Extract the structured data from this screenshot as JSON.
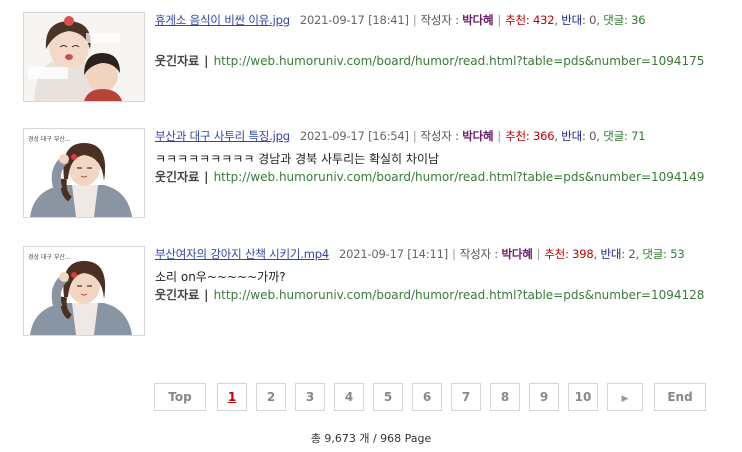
{
  "posts": [
    {
      "title": "휴게소 음식이 비싼 이유.jpg",
      "date": "2021-09-17 [18:41]",
      "author_label": "작성자 :",
      "author": "박다혜",
      "rec_label": "추천",
      "rec": ": 432",
      "opp_label": "반대",
      "opp": ": 0",
      "cmt_label": "댓글",
      "cmt": ": 36",
      "body": "",
      "src_label": "웃긴자료",
      "link": "http://web.humoruniv.com/board/humor/read.html?table=pds&number=1094175"
    },
    {
      "title": "부산과 대구 사투리 특징.jpg",
      "date": "2021-09-17 [16:54]",
      "author_label": "작성자 :",
      "author": "박다혜",
      "rec_label": "추천",
      "rec": ": 366",
      "opp_label": "반대",
      "opp": ": 0",
      "cmt_label": "댓글",
      "cmt": ": 71",
      "body": "ㅋㅋㅋㅋㅋㅋㅋㅋㅋ 경남과 경북 사투리는 확실히 차이남",
      "src_label": "웃긴자료",
      "link": "http://web.humoruniv.com/board/humor/read.html?table=pds&number=1094149"
    },
    {
      "title": "부산여자의 강아지 산책 시키기.mp4",
      "date": "2021-09-17 [14:11]",
      "author_label": "작성자 :",
      "author": "박다혜",
      "rec_label": "추천",
      "rec": ": 398",
      "opp_label": "반대",
      "opp": ": 2",
      "cmt_label": "댓글",
      "cmt": ": 53",
      "body": "소리 on우~~~~~가까?",
      "src_label": "웃긴자료",
      "link": "http://web.humoruniv.com/board/humor/read.html?table=pds&number=1094128"
    }
  ],
  "pagination": {
    "first": "Top",
    "pages": [
      "1",
      "2",
      "3",
      "4",
      "5",
      "6",
      "7",
      "8",
      "9",
      "10"
    ],
    "current": "1",
    "next_icon": "next-arrow-icon",
    "next_glyph": "▶",
    "last": "End"
  },
  "footer": "총 9,673 개 / 968 Page",
  "colors": {
    "title_link": "#3344aa",
    "author": "#6b1f6b",
    "recommend": "#c40000",
    "oppose": "#1a1a8c",
    "comments": "#2d7a2d",
    "url": "#3a7a3a"
  }
}
